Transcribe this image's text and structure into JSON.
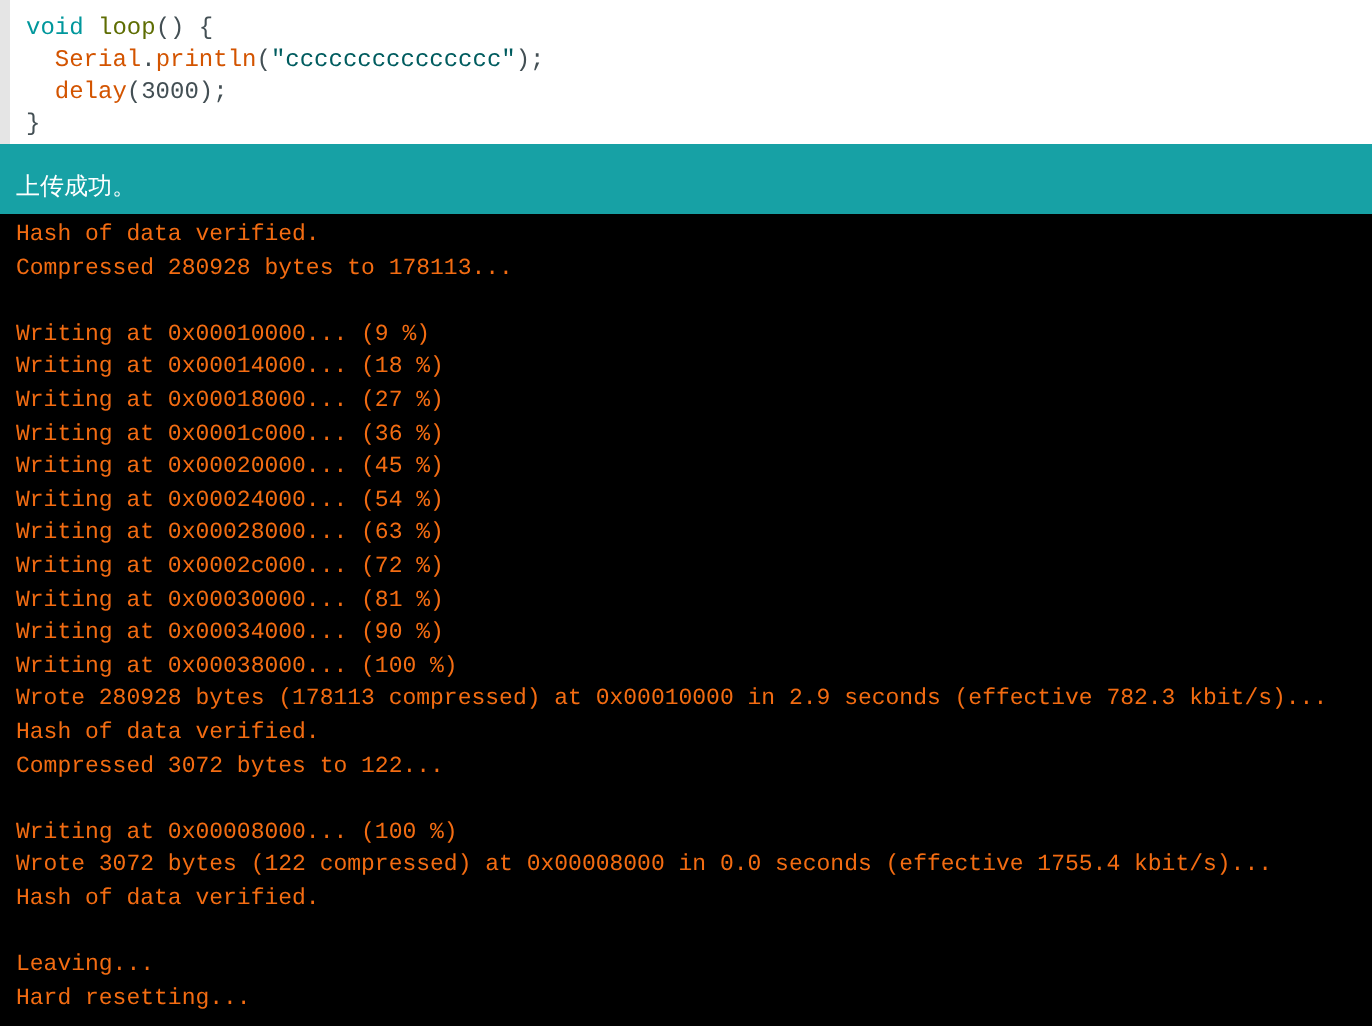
{
  "editor": {
    "lines": [
      {
        "indented": false,
        "tokens": [
          {
            "kind": "keyword",
            "text": "void "
          },
          {
            "kind": "function",
            "text": "loop"
          },
          {
            "kind": "plain",
            "text": "() {"
          }
        ]
      },
      {
        "indented": true,
        "tokens": [
          {
            "kind": "builtin",
            "text": "Serial"
          },
          {
            "kind": "plain",
            "text": "."
          },
          {
            "kind": "builtin",
            "text": "println"
          },
          {
            "kind": "plain",
            "text": "("
          },
          {
            "kind": "string",
            "text": "\"ccccccccccccccc\""
          },
          {
            "kind": "plain",
            "text": ");"
          }
        ]
      },
      {
        "indented": true,
        "tokens": [
          {
            "kind": "builtin",
            "text": "delay"
          },
          {
            "kind": "plain",
            "text": "(3000);"
          }
        ]
      },
      {
        "indented": false,
        "tokens": [
          {
            "kind": "plain",
            "text": "}"
          }
        ]
      }
    ]
  },
  "status_bar": {
    "message": "上传成功。"
  },
  "console": {
    "lines": [
      {
        "kind": "output",
        "text": "Hash of data verified."
      },
      {
        "kind": "output",
        "text": "Compressed 280928 bytes to 178113..."
      },
      {
        "kind": "blank"
      },
      {
        "kind": "output",
        "text": "Writing at 0x00010000... (9 %)"
      },
      {
        "kind": "output",
        "text": "Writing at 0x00014000... (18 %)"
      },
      {
        "kind": "output",
        "text": "Writing at 0x00018000... (27 %)"
      },
      {
        "kind": "output",
        "text": "Writing at 0x0001c000... (36 %)"
      },
      {
        "kind": "output",
        "text": "Writing at 0x00020000... (45 %)"
      },
      {
        "kind": "output",
        "text": "Writing at 0x00024000... (54 %)"
      },
      {
        "kind": "output",
        "text": "Writing at 0x00028000... (63 %)"
      },
      {
        "kind": "output",
        "text": "Writing at 0x0002c000... (72 %)"
      },
      {
        "kind": "output",
        "text": "Writing at 0x00030000... (81 %)"
      },
      {
        "kind": "output",
        "text": "Writing at 0x00034000... (90 %)"
      },
      {
        "kind": "output",
        "text": "Writing at 0x00038000... (100 %)"
      },
      {
        "kind": "output",
        "text": "Wrote 280928 bytes (178113 compressed) at 0x00010000 in 2.9 seconds (effective 782.3 kbit/s)..."
      },
      {
        "kind": "output",
        "text": "Hash of data verified."
      },
      {
        "kind": "output",
        "text": "Compressed 3072 bytes to 122..."
      },
      {
        "kind": "blank"
      },
      {
        "kind": "output",
        "text": "Writing at 0x00008000... (100 %)"
      },
      {
        "kind": "output",
        "text": "Wrote 3072 bytes (122 compressed) at 0x00008000 in 0.0 seconds (effective 1755.4 kbit/s)..."
      },
      {
        "kind": "output",
        "text": "Hash of data verified."
      },
      {
        "kind": "blank"
      },
      {
        "kind": "output",
        "text": "Leaving..."
      },
      {
        "kind": "output",
        "text": "Hard resetting..."
      }
    ]
  }
}
